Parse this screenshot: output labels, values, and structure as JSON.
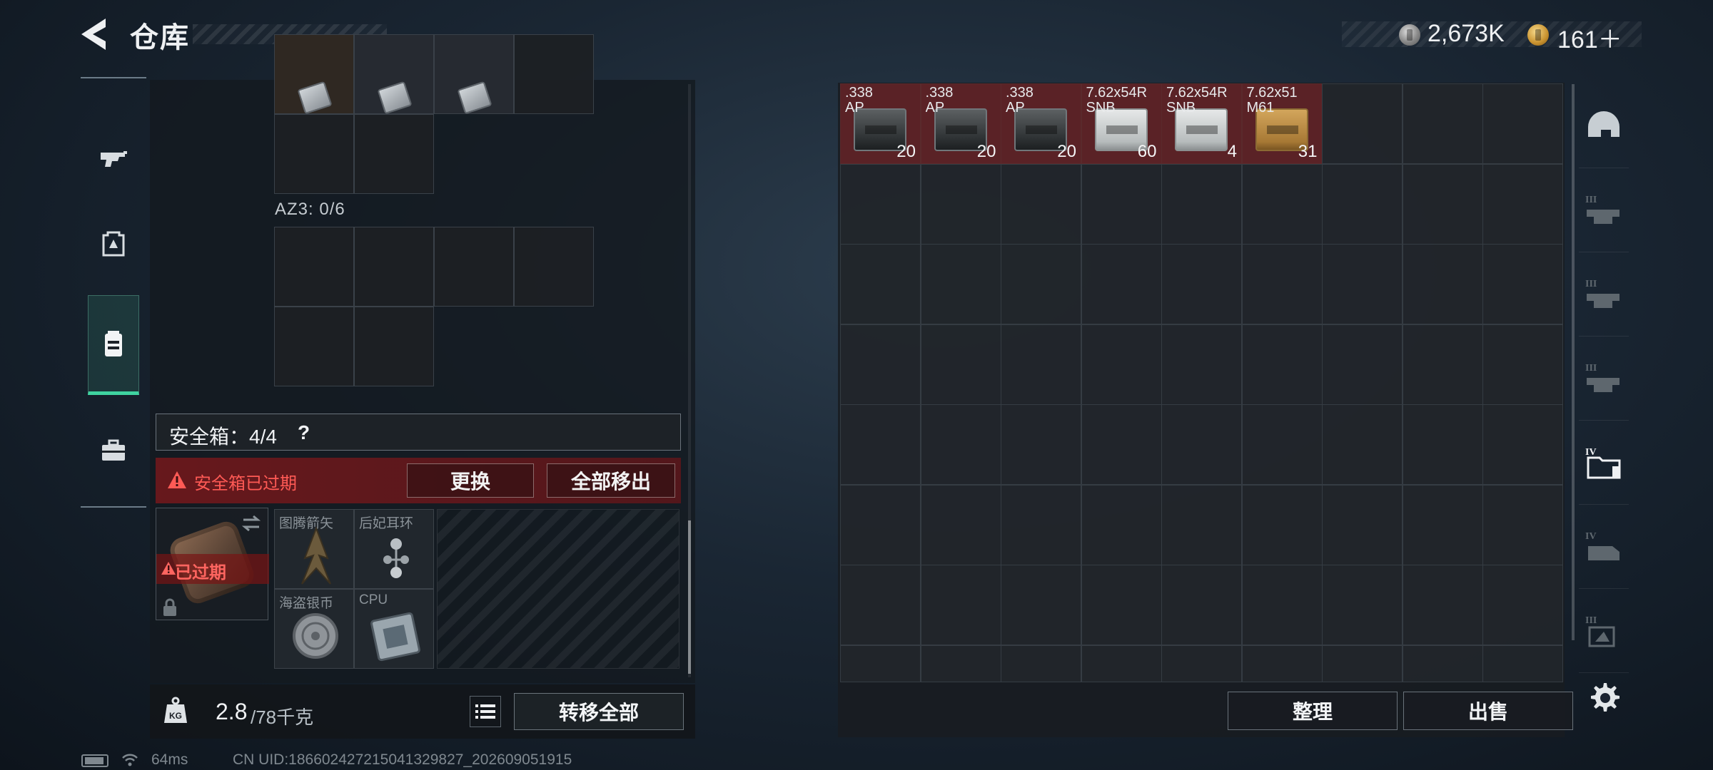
{
  "header": {
    "title": "仓库",
    "currency_silver": "2,673K",
    "currency_gold": "161＋"
  },
  "left_nav": [
    "weapon-icon",
    "backpack-icon",
    "safe-case-icon",
    "toolbox-icon"
  ],
  "container": {
    "az3_label": "AZ3: 0/6"
  },
  "safe": {
    "label": "安全箱：4/4",
    "help": "?",
    "warning": "安全箱已过期",
    "replace_btn": "更换",
    "move_all_btn": "全部移出",
    "expired_label": "已过期",
    "slots": [
      {
        "name": "图腾箭矢"
      },
      {
        "name": "后妃耳环"
      },
      {
        "name": "海盗银币"
      },
      {
        "name": "CPU"
      }
    ]
  },
  "weight": {
    "current": "2.8",
    "max": "/78千克",
    "transfer_btn": "转移全部"
  },
  "storage": {
    "items": [
      {
        "name": ".338\nAP",
        "count": "20",
        "box": "dark"
      },
      {
        "name": ".338\nAP",
        "count": "20",
        "box": "dark"
      },
      {
        "name": ".338\nAP",
        "count": "20",
        "box": "dark"
      },
      {
        "name": "7.62x54R\nSNB",
        "count": "60",
        "box": "white"
      },
      {
        "name": "7.62x54R\nSNB",
        "count": "4",
        "box": "white"
      },
      {
        "name": "7.62x51\nM61",
        "count": "31",
        "box": "tan"
      }
    ],
    "sort_btn": "整理",
    "sell_btn": "出售"
  },
  "right_nav": [
    "helmet-tab",
    "III",
    "III",
    "III",
    "IV",
    "IV",
    "III"
  ],
  "status_bar": {
    "ping": "64ms",
    "uid": "CN UID:1866024272150413298​27_202609051915"
  }
}
